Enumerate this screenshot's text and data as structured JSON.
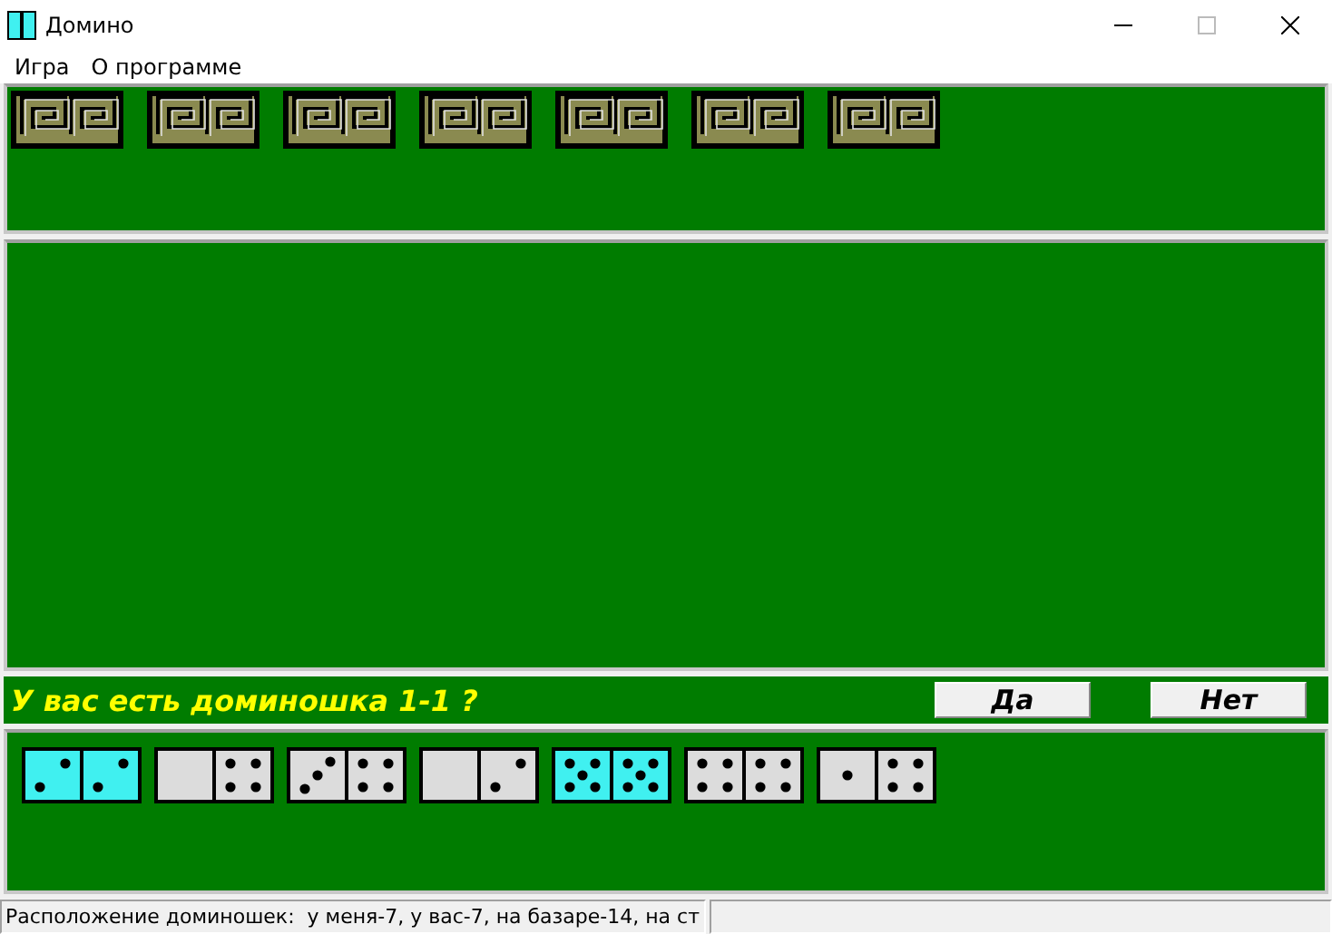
{
  "window": {
    "title": "Домино"
  },
  "menu": [
    "Игра",
    "О программе"
  ],
  "opponent_hand": [
    {
      "kind": "back"
    },
    {
      "kind": "back"
    },
    {
      "kind": "back"
    },
    {
      "kind": "back"
    },
    {
      "kind": "back"
    },
    {
      "kind": "back"
    },
    {
      "kind": "back"
    }
  ],
  "question": {
    "text": "У вас есть доминошка 1-1 ?",
    "buttons": [
      "Да",
      "Нет"
    ]
  },
  "player_hand": [
    {
      "halves": [
        {
          "kind": "two"
        },
        {
          "kind": "two"
        }
      ],
      "selected": true
    },
    {
      "halves": [
        {
          "kind": "blank"
        },
        {
          "kind": "four"
        }
      ],
      "selected": false
    },
    {
      "halves": [
        {
          "kind": "three"
        },
        {
          "kind": "four"
        }
      ],
      "selected": false
    },
    {
      "halves": [
        {
          "kind": "blank"
        },
        {
          "kind": "two"
        }
      ],
      "selected": false
    },
    {
      "halves": [
        {
          "kind": "five"
        },
        {
          "kind": "five"
        }
      ],
      "selected": true
    },
    {
      "halves": [
        {
          "kind": "four"
        },
        {
          "kind": "four"
        }
      ],
      "selected": false
    },
    {
      "halves": [
        {
          "kind": "one"
        },
        {
          "kind": "four"
        }
      ],
      "selected": false
    }
  ],
  "status_bar": {
    "text": "Расположение доминошек:  у меня-7, у вас-7, на базаре-14, на ст"
  }
}
